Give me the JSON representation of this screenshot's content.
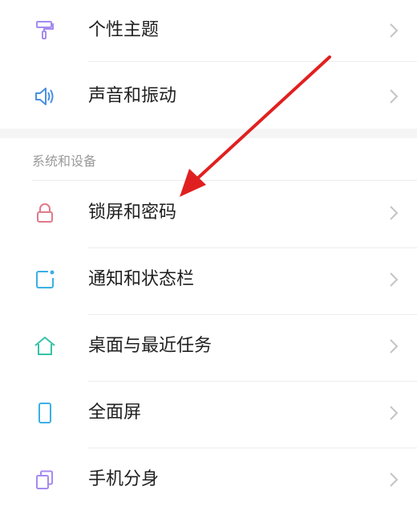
{
  "rows_top": [
    {
      "label": "个性主题",
      "icon": "theme-brush-icon"
    },
    {
      "label": "声音和振动",
      "icon": "speaker-icon"
    }
  ],
  "section": {
    "title": "系统和设备"
  },
  "rows_bottom": [
    {
      "label": "锁屏和密码",
      "icon": "lock-icon"
    },
    {
      "label": "通知和状态栏",
      "icon": "notification-icon"
    },
    {
      "label": "桌面与最近任务",
      "icon": "home-icon"
    },
    {
      "label": "全面屏",
      "icon": "phone-icon"
    },
    {
      "label": "手机分身",
      "icon": "clone-icon"
    }
  ],
  "colors": {
    "theme_icon": "#a58bf0",
    "sound_icon": "#4a90e2",
    "lock_icon": "#e07a8a",
    "notify_icon": "#3ab0e6",
    "home_icon": "#37c2a8",
    "phone_icon": "#3ab0e6",
    "clone_icon": "#a58bf0",
    "annotation_arrow": "#e02020"
  }
}
